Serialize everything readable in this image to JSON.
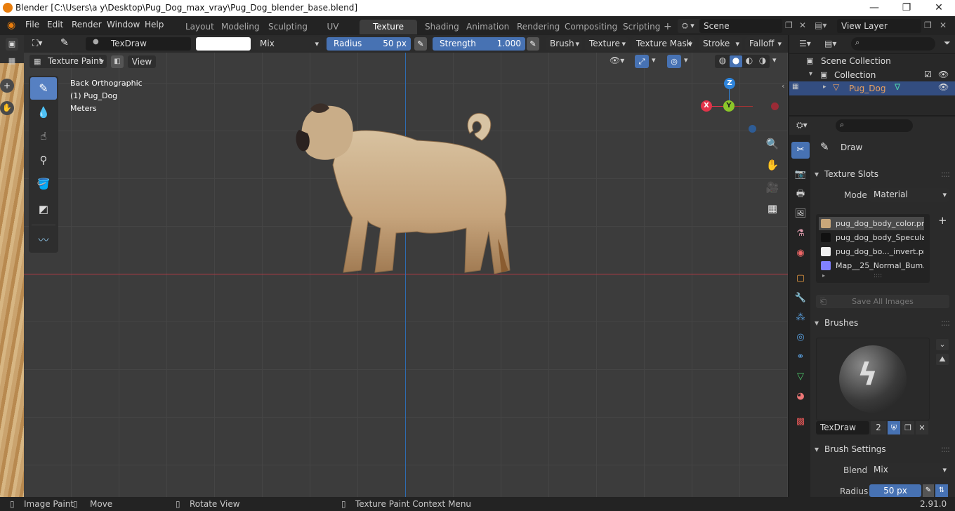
{
  "window": {
    "title": "Blender [C:\\Users\\a y\\Desktop\\Pug_Dog_max_vray\\Pug_Dog_blender_base.blend]",
    "minimize": "—",
    "maximize": "❐",
    "close": "✕"
  },
  "menu": {
    "file": "File",
    "edit": "Edit",
    "render": "Render",
    "window": "Window",
    "help": "Help"
  },
  "workspaces": [
    "Layout",
    "Modeling",
    "Sculpting",
    "UV Editing",
    "Texture Paint",
    "Shading",
    "Animation",
    "Rendering",
    "Compositing",
    "Scripting"
  ],
  "active_workspace": "Texture Paint",
  "scene": {
    "name": "Scene",
    "view_layer": "View Layer"
  },
  "tool_header": {
    "brush_name": "TexDraw",
    "blend_mode": "Mix",
    "radius_label": "Radius",
    "radius_value": "50 px",
    "strength_label": "Strength",
    "strength_value": "1.000",
    "strength_fraction": 1.0,
    "brush_menu": "Brush",
    "texture_menu": "Texture",
    "texture_mask_menu": "Texture Mask",
    "stroke_menu": "Stroke",
    "falloff_menu": "Falloff"
  },
  "viewport_header": {
    "mode": "Texture Paint",
    "view": "View"
  },
  "viewport_info": {
    "view": "Back Orthographic",
    "object": "(1) Pug_Dog",
    "units": "Meters"
  },
  "gizmo": {
    "x": "X",
    "y": "Y",
    "z": "Z"
  },
  "outliner": {
    "scene_collection": "Scene Collection",
    "collection": "Collection",
    "object": "Pug_Dog"
  },
  "properties": {
    "active_tool": "Draw",
    "texture_slots": {
      "title": "Texture Slots",
      "mode_label": "Mode",
      "mode_value": "Material",
      "slots": [
        {
          "name": "pug_dog_body_color.png",
          "color": "#c9a77a"
        },
        {
          "name": "pug_dog_body_Specula...",
          "color": "#111111"
        },
        {
          "name": "pug_dog_bo..._invert.png",
          "color": "#f0f0f0"
        },
        {
          "name": "Map__25_Normal_Bum...",
          "color": "#8080ff"
        }
      ],
      "save_all": "Save All Images"
    },
    "brushes": {
      "title": "Brushes",
      "brush_name": "TexDraw",
      "users": "2"
    },
    "brush_settings": {
      "title": "Brush Settings",
      "blend_label": "Blend",
      "blend_value": "Mix",
      "radius_label": "Radius",
      "radius_value": "50 px"
    }
  },
  "statusbar": {
    "left_click": "Image Paint",
    "middle_click": "Move",
    "rotate": "Rotate View",
    "context": "Texture Paint Context Menu",
    "version": "2.91.0"
  },
  "colors": {
    "accent": "#5680c2",
    "active_tab": "#3d3d3d",
    "x_axis": "#e2344a",
    "y_axis": "#8bc729",
    "z_axis": "#2e84db"
  }
}
